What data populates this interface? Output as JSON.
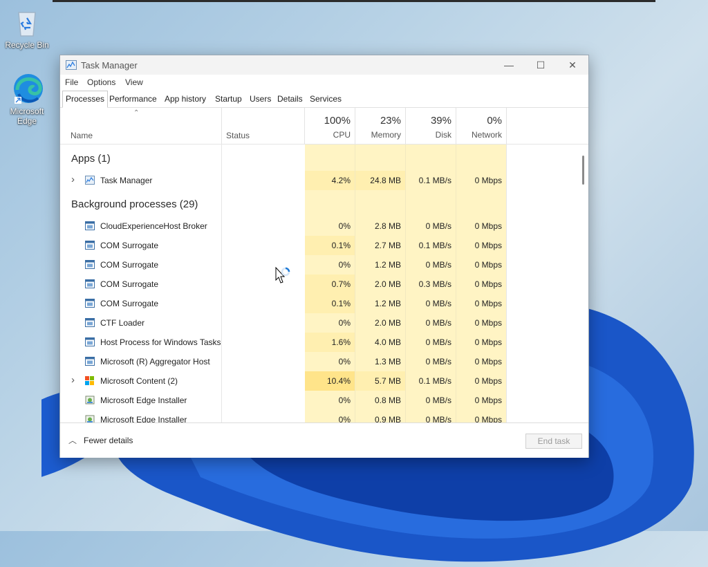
{
  "desktop": {
    "icons": [
      {
        "label": "Recycle Bin",
        "icon": "recycle-bin-icon"
      },
      {
        "label": "Microsoft Edge",
        "icon": "edge-icon"
      }
    ]
  },
  "window": {
    "title": "Task Manager",
    "controls": {
      "minimize": "—",
      "maximize": "☐",
      "close": "✕"
    },
    "menu": [
      "File",
      "Options",
      "View"
    ],
    "tabs": [
      "Processes",
      "Performance",
      "App history",
      "Startup",
      "Users",
      "Details",
      "Services"
    ],
    "active_tab": "Processes"
  },
  "columns": {
    "name": "Name",
    "status": "Status",
    "cpu": {
      "pct": "100%",
      "label": "CPU"
    },
    "memory": {
      "pct": "23%",
      "label": "Memory"
    },
    "disk": {
      "pct": "39%",
      "label": "Disk"
    },
    "network": {
      "pct": "0%",
      "label": "Network"
    }
  },
  "groups": {
    "apps": "Apps (1)",
    "background": "Background processes (29)"
  },
  "apps": [
    {
      "name": "Task Manager",
      "cpu": "4.2%",
      "memory": "24.8 MB",
      "disk": "0.1 MB/s",
      "network": "0 Mbps",
      "expandable": true,
      "icon": "task-manager-icon"
    }
  ],
  "background": [
    {
      "name": "CloudExperienceHost Broker",
      "cpu": "0%",
      "memory": "2.8 MB",
      "disk": "0 MB/s",
      "network": "0 Mbps",
      "icon": "window-app-icon"
    },
    {
      "name": "COM Surrogate",
      "cpu": "0.1%",
      "memory": "2.7 MB",
      "disk": "0.1 MB/s",
      "network": "0 Mbps",
      "icon": "window-app-icon"
    },
    {
      "name": "COM Surrogate",
      "cpu": "0%",
      "memory": "1.2 MB",
      "disk": "0 MB/s",
      "network": "0 Mbps",
      "icon": "window-app-icon"
    },
    {
      "name": "COM Surrogate",
      "cpu": "0.7%",
      "memory": "2.0 MB",
      "disk": "0.3 MB/s",
      "network": "0 Mbps",
      "icon": "window-app-icon"
    },
    {
      "name": "COM Surrogate",
      "cpu": "0.1%",
      "memory": "1.2 MB",
      "disk": "0 MB/s",
      "network": "0 Mbps",
      "icon": "window-app-icon"
    },
    {
      "name": "CTF Loader",
      "cpu": "0%",
      "memory": "2.0 MB",
      "disk": "0 MB/s",
      "network": "0 Mbps",
      "icon": "window-app-icon"
    },
    {
      "name": "Host Process for Windows Tasks",
      "cpu": "1.6%",
      "memory": "4.0 MB",
      "disk": "0 MB/s",
      "network": "0 Mbps",
      "icon": "window-app-icon"
    },
    {
      "name": "Microsoft (R) Aggregator Host",
      "cpu": "0%",
      "memory": "1.3 MB",
      "disk": "0 MB/s",
      "network": "0 Mbps",
      "icon": "window-app-icon"
    },
    {
      "name": "Microsoft Content (2)",
      "cpu": "10.4%",
      "memory": "5.7 MB",
      "disk": "0.1 MB/s",
      "network": "0 Mbps",
      "expandable": true,
      "icon": "microsoft-logo-icon"
    },
    {
      "name": "Microsoft Edge Installer",
      "cpu": "0%",
      "memory": "0.8 MB",
      "disk": "0 MB/s",
      "network": "0 Mbps",
      "icon": "installer-icon"
    },
    {
      "name": "Microsoft Edge Installer",
      "cpu": "0%",
      "memory": "0.9 MB",
      "disk": "0 MB/s",
      "network": "0 Mbps",
      "icon": "installer-icon"
    }
  ],
  "footer": {
    "fewer_details": "Fewer details",
    "end_task": "End task"
  },
  "colors": {
    "heat_light": "#fff4c4",
    "heat_mid": "#ffefb0",
    "heat_high": "#ffe48a",
    "accent": "#0078d4"
  }
}
